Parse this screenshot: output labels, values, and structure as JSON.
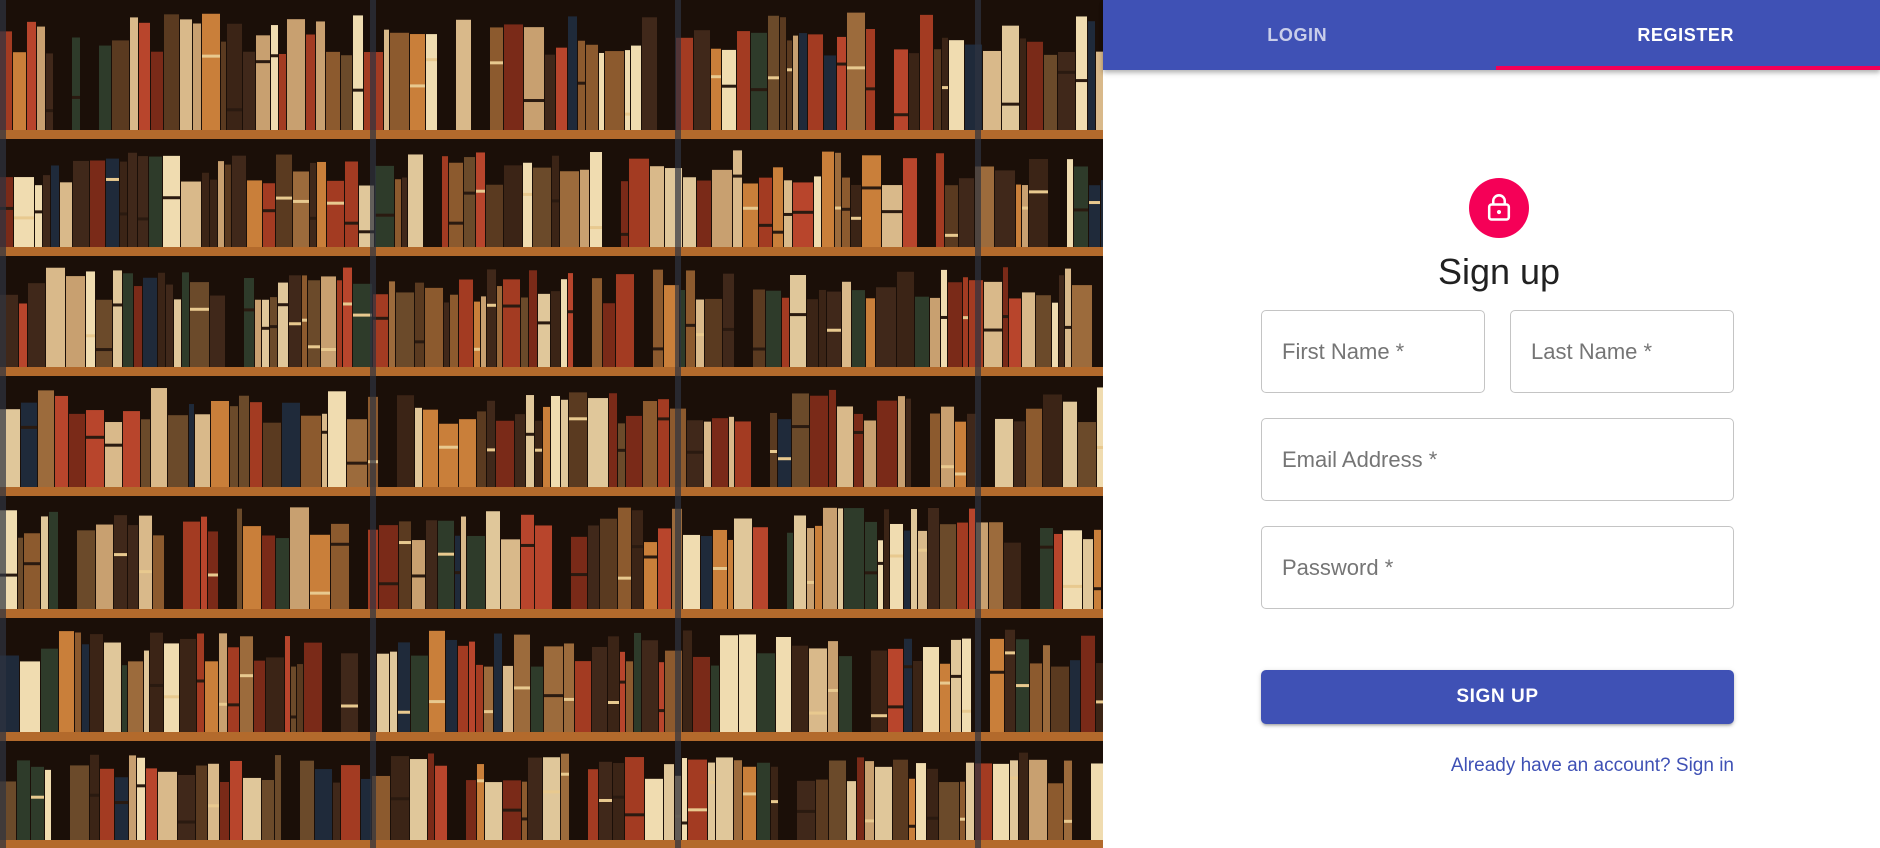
{
  "tabs": [
    {
      "label": "LOGIN",
      "active": false
    },
    {
      "label": "REGISTER",
      "active": true
    }
  ],
  "form": {
    "icon": "lock-icon",
    "title": "Sign up",
    "first_name_placeholder": "First Name *",
    "last_name_placeholder": "Last Name *",
    "email_placeholder": "Email Address *",
    "password_placeholder": "Password *",
    "submit_label": "SIGN UP",
    "signin_link": "Already have an account? Sign in"
  },
  "colors": {
    "primary": "#3f51b5",
    "secondary": "#f50057",
    "border": "#c4c4c4",
    "placeholder": "#757575"
  },
  "hero": {
    "image": "bookshelf"
  }
}
